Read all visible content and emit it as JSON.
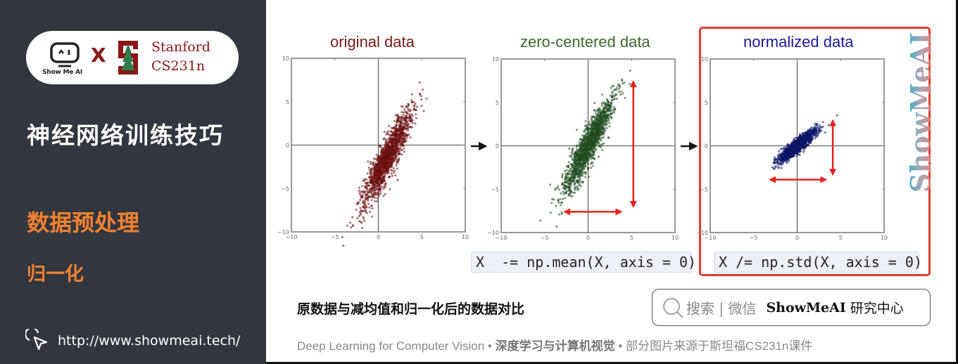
{
  "sidebar": {
    "brand_left": "Show Me AI",
    "brand_x": "X",
    "brand_right_line1": "Stanford",
    "brand_right_line2": "CS231n",
    "course_title": "神经网络训练技巧",
    "section_title": "数据预处理",
    "subsection_title": "归一化",
    "url": "http://www.showmeai.tech/",
    "icons": {
      "logo": "showmeai-robot-icon",
      "stanford": "stanford-tree-icon",
      "cursor": "cursor-click-icon"
    }
  },
  "colors": {
    "sidebar_bg": "#31363f",
    "accent_orange": "#f3812f",
    "stanford_red": "#8c1515",
    "original": "#6b0f0f",
    "zero_centered": "#1f4d1f",
    "normalized": "#0d1766",
    "arrow_red": "#e5221b",
    "highlight_border": "#e53a2e"
  },
  "chart_data": [
    {
      "type": "scatter",
      "title": "original data",
      "title_color": "#7a1a1a",
      "xlim": [
        -10,
        10
      ],
      "ylim": [
        -10,
        10
      ],
      "xticks": [
        "-10",
        "-5",
        "0",
        "5",
        "10"
      ],
      "yticks": [
        "10",
        "5",
        "0",
        "-5",
        "-10"
      ],
      "axes_lines_at_zero": true,
      "cloud": {
        "mean": [
          1.0,
          -1.5
        ],
        "major_std": 3.0,
        "minor_std": 0.55,
        "angle_deg": 64,
        "n": 1500
      },
      "point_color": "#6b0f0f"
    },
    {
      "type": "scatter",
      "title": "zero-centered data",
      "title_color": "#3a6b2a",
      "xlim": [
        -10,
        10
      ],
      "ylim": [
        -10,
        10
      ],
      "xticks": [
        "-10",
        "-5",
        "0",
        "5",
        "10"
      ],
      "yticks": [
        "10",
        "5",
        "0",
        "-5",
        "-10"
      ],
      "axes_lines_at_zero": true,
      "cloud": {
        "mean": [
          0,
          0
        ],
        "major_std": 3.0,
        "minor_std": 0.55,
        "angle_deg": 64,
        "n": 1500
      },
      "point_color": "#1f4d1f",
      "annotations": [
        {
          "type": "double-arrow",
          "orientation": "vertical",
          "x": 5.2,
          "y_from": 7.4,
          "y_to": -7.0
        },
        {
          "type": "double-arrow",
          "orientation": "horizontal",
          "y": -7.6,
          "x_from": -2.7,
          "x_to": 3.8
        }
      ]
    },
    {
      "type": "scatter",
      "title": "normalized data",
      "title_color": "#1a1a9a",
      "xlim": [
        -10,
        10
      ],
      "ylim": [
        -10,
        10
      ],
      "xticks": [
        "-10",
        "-5",
        "0",
        "5",
        "10"
      ],
      "yticks": [
        "10",
        "5",
        "0",
        "-5",
        "-10"
      ],
      "axes_lines_at_zero": true,
      "cloud": {
        "mean": [
          0,
          0
        ],
        "major_std": 1.35,
        "minor_std": 0.3,
        "angle_deg": 40,
        "n": 1500
      },
      "point_color": "#0d1766",
      "annotations": [
        {
          "type": "double-arrow",
          "orientation": "vertical",
          "x": 4.1,
          "y_from": 2.9,
          "y_to": -3.3
        },
        {
          "type": "double-arrow",
          "orientation": "horizontal",
          "y": -3.9,
          "x_from": -3.1,
          "x_to": 3.3
        }
      ]
    }
  ],
  "code": {
    "mean_step": "X  -= np.mean(X, axis = 0)",
    "std_step": "X /= np.std(X, axis = 0)"
  },
  "caption": "原数据与减均值和归一化后的数据对比",
  "search": {
    "hint": "搜索 | 微信",
    "brand": "ShowMeAI",
    "brand_suffix": "研究中心",
    "icon": "search-icon"
  },
  "footer": {
    "part1": "Deep Learning for Computer Vision",
    "sep": " • ",
    "part2": "深度学习与计算机视觉",
    "part3": "部分图片来源于斯坦福CS231n课件"
  },
  "watermark": "ShowMeAI"
}
